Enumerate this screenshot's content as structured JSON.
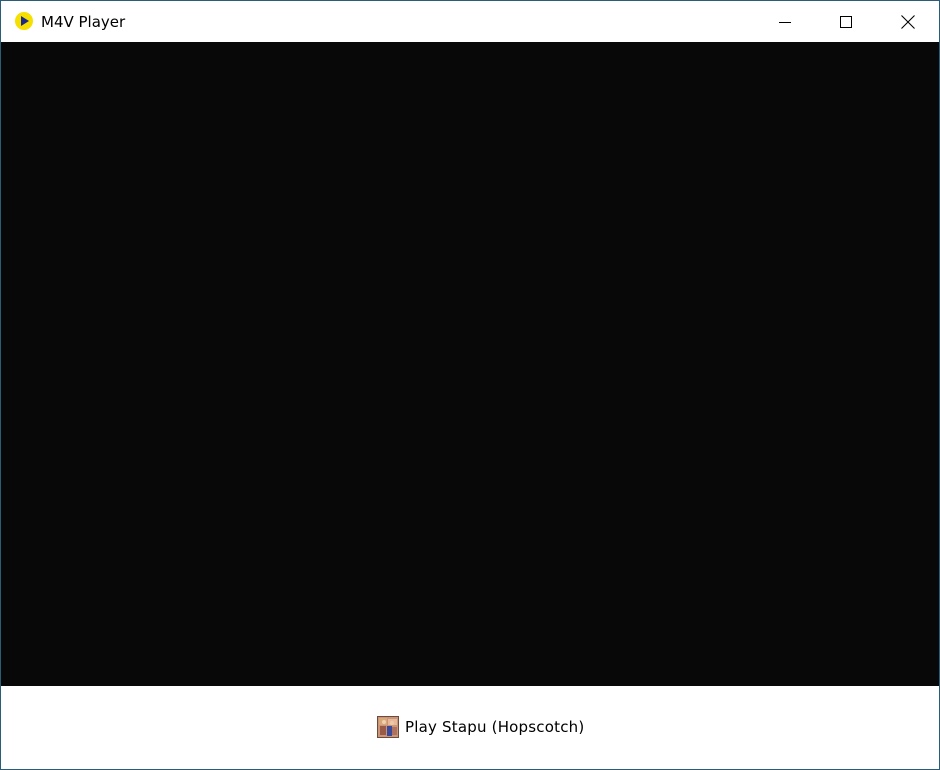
{
  "window": {
    "title": "M4V Player",
    "app_icon": "play-circle-icon",
    "controls": {
      "minimize": "minimize-icon",
      "maximize": "maximize-icon",
      "close": "close-icon"
    }
  },
  "video": {
    "background": "#080808"
  },
  "bottom": {
    "play_label": "Play Stapu (Hopscotch)",
    "thumbnail_icon": "video-thumbnail-icon"
  },
  "colors": {
    "app_icon_fill": "#f5e000",
    "app_icon_arrow": "#1a2a8c",
    "window_border": "#2b5c78"
  }
}
